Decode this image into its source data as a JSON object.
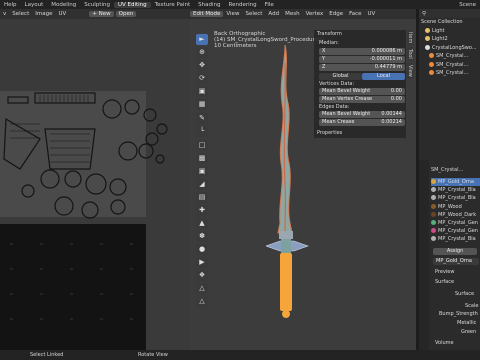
{
  "topbar": {
    "menus": [
      "Help",
      "Layout",
      "Modeling",
      "Sculpting",
      "UV Editing",
      "Texture Paint",
      "Shading",
      "Rendering",
      "File"
    ],
    "scene": "Scene"
  },
  "uv": {
    "header": [
      "v",
      "Select",
      "Image",
      "UV"
    ],
    "new": "+ New",
    "open": "Open"
  },
  "viewport": {
    "header": [
      "Edit Mode",
      "View",
      "Select",
      "Add",
      "Mesh",
      "Vertex",
      "Edge",
      "Face",
      "UV"
    ],
    "options": "Options",
    "view_name": "Back Orthographic",
    "object_name": "(14) SM_CrystalLongSword_ProceduralM",
    "scale": "10 Centimeters"
  },
  "npanel": {
    "title": "Transform",
    "median": "Median:",
    "x_label": "X",
    "x_val": "0.000086 m",
    "y_label": "Y",
    "y_val": "-0.000011 m",
    "z_label": "Z",
    "z_val": "0.44779 m",
    "global": "Global",
    "local": "Local",
    "vertices": "Vertices Data:",
    "bevel_w": "Mean Bevel Weight",
    "bevel_v": "0.00",
    "crease_w": "Mean Vertex Crease",
    "crease_v": "0.00",
    "edges": "Edges Data:",
    "ebevel_w": "Mean Bevel Weight",
    "ebevel_v": "0.00144",
    "ecrease_w": "Mean Crease",
    "ecrease_v": "0.00214",
    "properties": "Properties",
    "tabs": [
      "Item",
      "Tool",
      "View"
    ]
  },
  "outliner": {
    "items": [
      "Scene Collection",
      "Light",
      "Light2",
      "CrystalLongSwo...",
      "SM_Crystal...",
      "SM_Crystal...",
      "SM_Crystal..."
    ]
  },
  "materials": {
    "object": "SM_Crystal...",
    "slots": [
      {
        "name": "MP_Gold_Orna",
        "color": "#d9a53b"
      },
      {
        "name": "MP_Crystal_Bla",
        "color": "#b0b0b0"
      },
      {
        "name": "MP_Crystal_Bla",
        "color": "#b0b0b0"
      },
      {
        "name": "MP_Wood",
        "color": "#8a5a2b"
      },
      {
        "name": "MP_Wood_Dark",
        "color": "#6b4424"
      },
      {
        "name": "MP_Crystal_Gen",
        "color": "#55b07a"
      },
      {
        "name": "MP_Crystal_Gen",
        "color": "#d04a8a"
      },
      {
        "name": "MP_Crystal_Bla",
        "color": "#b0b0b0"
      }
    ],
    "assign": "Assign",
    "active": "MP_Gold_Orna",
    "preview": "Preview",
    "surface": "Surface",
    "props": [
      "Surface",
      "Scale",
      "Bump_Strength",
      "Metallic",
      "Green",
      "Volume"
    ]
  },
  "statusbar": {
    "left": "Select Linked",
    "mid": "Rotate View"
  }
}
